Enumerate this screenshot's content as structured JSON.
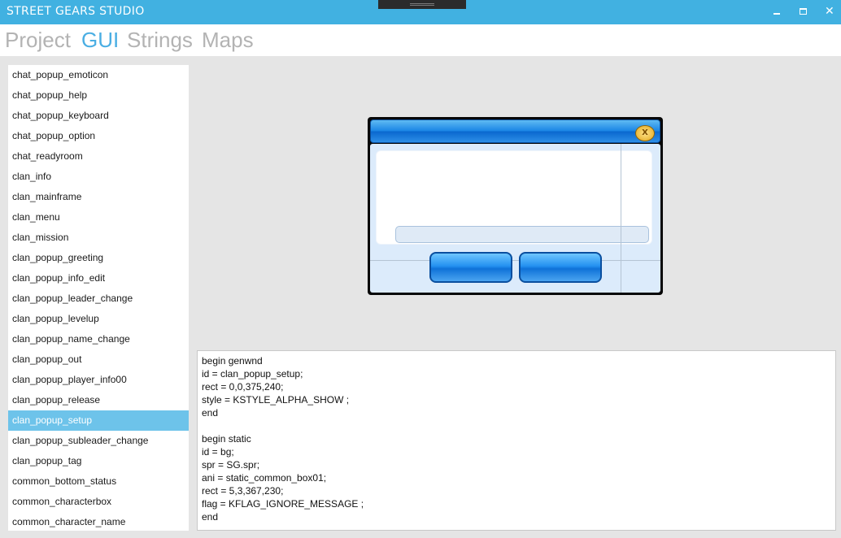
{
  "window": {
    "title": "STREET GEARS STUDIO",
    "minimize_icon": "minimize-icon",
    "maximize_icon": "maximize-icon",
    "close_icon": "close-icon",
    "close_glyph": "✕",
    "accent_color": "#41b1e1"
  },
  "nav": {
    "tabs": [
      "Project",
      "GUI",
      "Strings",
      "Maps"
    ],
    "active": "GUI",
    "active_color": "#4aaee3",
    "inactive_color": "#b3b3b3"
  },
  "sidebar": {
    "selected": "clan_popup_setup",
    "selected_color": "#6dc3ea",
    "items": [
      "chat_popup_emoticon",
      "chat_popup_help",
      "chat_popup_keyboard",
      "chat_popup_option",
      "chat_readyroom",
      "clan_info",
      "clan_mainframe",
      "clan_menu",
      "clan_mission",
      "clan_popup_greeting",
      "clan_popup_info_edit",
      "clan_popup_leader_change",
      "clan_popup_levelup",
      "clan_popup_name_change",
      "clan_popup_out",
      "clan_popup_player_info00",
      "clan_popup_release",
      "clan_popup_setup",
      "clan_popup_subleader_change",
      "clan_popup_tag",
      "common_bottom_status",
      "common_characterbox",
      "common_character_name"
    ]
  },
  "preview": {
    "close_icon": "x-circle-icon",
    "close_glyph": "X",
    "header_color": "#1b86e6",
    "body_color": "#dcebfb"
  },
  "script": {
    "lines": [
      "begin genwnd",
      "id = clan_popup_setup;",
      "rect = 0,0,375,240;",
      "style = KSTYLE_ALPHA_SHOW ;",
      "end",
      "",
      "begin static",
      "id = bg;",
      "spr = SG.spr;",
      "ani = static_common_box01;",
      "rect = 5,3,367,230;",
      "flag = KFLAG_IGNORE_MESSAGE ;",
      "end"
    ]
  }
}
